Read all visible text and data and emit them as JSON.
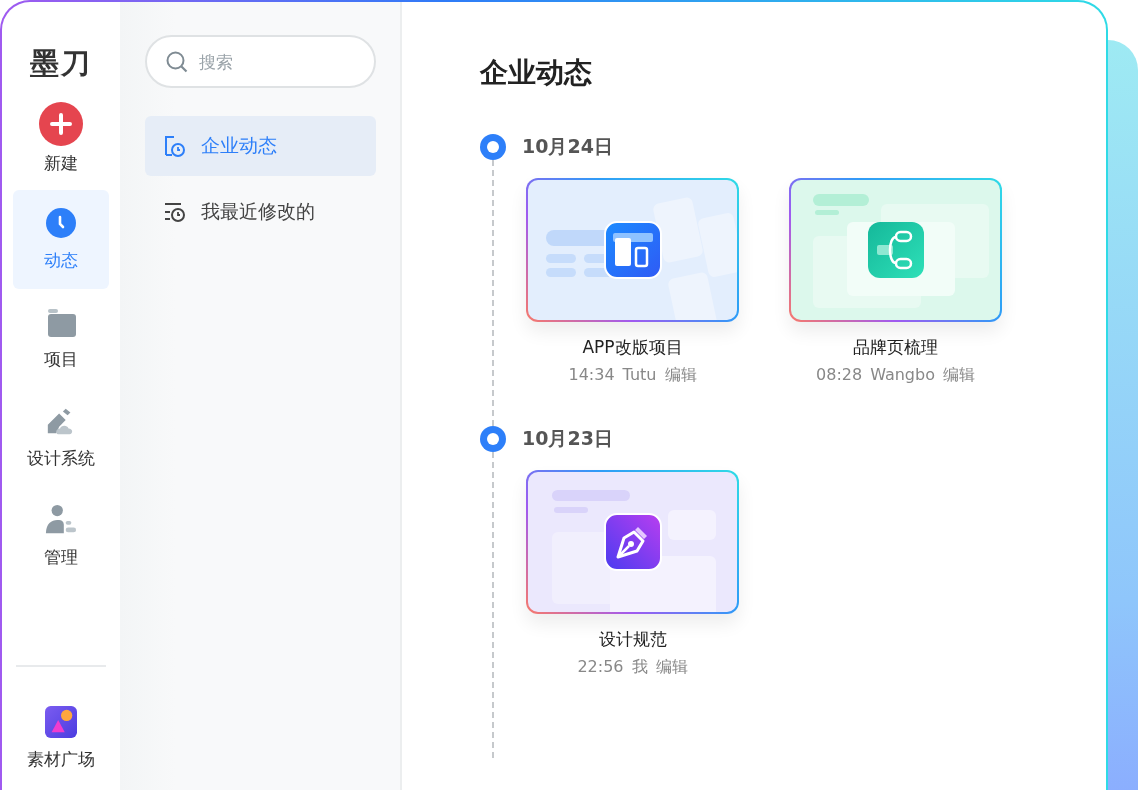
{
  "logo": "墨刀",
  "nav": [
    {
      "kind": "new",
      "label": "新建",
      "selected": false
    },
    {
      "kind": "clock",
      "label": "动态",
      "selected": true
    },
    {
      "kind": "folder",
      "label": "项目",
      "selected": false
    },
    {
      "kind": "design",
      "label": "设计系统",
      "selected": false
    },
    {
      "kind": "admin",
      "label": "管理",
      "selected": false
    }
  ],
  "nav_bottom": [
    {
      "kind": "assets",
      "label": "素材广场",
      "selected": false
    }
  ],
  "search": {
    "placeholder": "搜索"
  },
  "sidebar": {
    "items": [
      {
        "kind": "team",
        "label": "企业动态",
        "selected": true
      },
      {
        "kind": "recent",
        "label": "我最近修改的",
        "selected": false
      }
    ]
  },
  "main": {
    "title": "企业动态",
    "groups": [
      {
        "date": "10月24日",
        "files": [
          {
            "kind": "app",
            "name": "APP改版项目",
            "time": "14:34",
            "user": "Tutu",
            "action": "编辑"
          },
          {
            "kind": "mindmap",
            "name": "品牌页梳理",
            "time": "08:28",
            "user": "Wangbo",
            "action": "编辑"
          }
        ]
      },
      {
        "date": "10月23日",
        "files": [
          {
            "kind": "design",
            "name": "设计规范",
            "time": "22:56",
            "user": "我",
            "action": "编辑"
          }
        ]
      }
    ]
  }
}
